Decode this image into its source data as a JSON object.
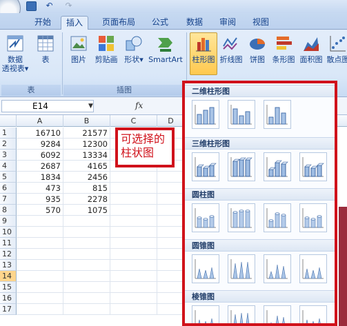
{
  "quick_access": {
    "save_icon": "save-icon",
    "undo_icon": "undo-icon",
    "redo_icon": "redo-icon"
  },
  "tabs": [
    {
      "label": "开始",
      "active": false
    },
    {
      "label": "插入",
      "active": true
    },
    {
      "label": "页面布局",
      "active": false
    },
    {
      "label": "公式",
      "active": false
    },
    {
      "label": "数据",
      "active": false
    },
    {
      "label": "审阅",
      "active": false
    },
    {
      "label": "视图",
      "active": false
    }
  ],
  "ribbon": {
    "pivot": {
      "line1": "数据",
      "line2": "透视表",
      "arrow": "▾"
    },
    "table": {
      "label": "表"
    },
    "picture": {
      "label": "图片"
    },
    "clipart": {
      "label": "剪贴画"
    },
    "shapes": {
      "label": "形状",
      "arrow": "▾"
    },
    "smartart": {
      "label": "SmartArt"
    },
    "column": {
      "label": "柱形图"
    },
    "line": {
      "label": "折线图"
    },
    "pie": {
      "label": "饼图"
    },
    "bar": {
      "label": "条形图"
    },
    "area": {
      "label": "面积图"
    },
    "scatter": {
      "label": "散点图"
    },
    "groups": {
      "tables": "表",
      "illustrations": "插图"
    }
  },
  "formula_bar": {
    "name_box": "E14",
    "fx": "fx"
  },
  "sheet": {
    "columns": [
      "A",
      "B",
      "C",
      "D"
    ],
    "rows": [
      "1",
      "2",
      "3",
      "4",
      "5",
      "6",
      "7",
      "8",
      "9",
      "10",
      "11",
      "12",
      "13",
      "14",
      "15",
      "16",
      "17"
    ],
    "selected_row": "14",
    "data": [
      [
        "16710",
        "21577"
      ],
      [
        "9284",
        "12300"
      ],
      [
        "6092",
        "13334"
      ],
      [
        "2687",
        "4165"
      ],
      [
        "1834",
        "2456"
      ],
      [
        "473",
        "815"
      ],
      [
        "935",
        "2278"
      ],
      [
        "570",
        "1075"
      ]
    ]
  },
  "annotation": {
    "line1": "可选择的",
    "line2": "柱状图",
    "color": "#d0121b"
  },
  "gallery": {
    "sections": [
      "二维柱形图",
      "三维柱形图",
      "圆柱图",
      "圆锥图",
      "棱锥图"
    ]
  },
  "colors": {
    "accent": "#d0121b",
    "ribbon_text": "#15428b",
    "active_button": "#ffc94f"
  }
}
